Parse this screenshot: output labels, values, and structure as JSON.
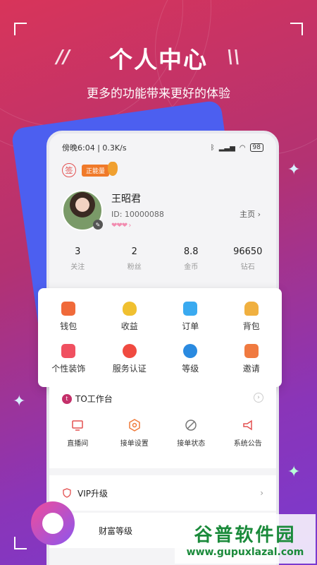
{
  "promo": {
    "headline": "个人中心",
    "subtitle": "更多的功能带来更好的体验"
  },
  "statusbar": {
    "time_info": "傍晚6:04 | 0.3K/s",
    "battery": "98"
  },
  "sign_in": {
    "label": "签"
  },
  "positive_badge": {
    "label": "正能量"
  },
  "profile": {
    "name": "王昭君",
    "id_text": "ID: 10000088",
    "homepage_label": "主页"
  },
  "stats": [
    {
      "value": "3",
      "label": "关注"
    },
    {
      "value": "2",
      "label": "粉丝"
    },
    {
      "value": "8.8",
      "label": "金币"
    },
    {
      "value": "96650",
      "label": "钻石"
    }
  ],
  "menu": [
    {
      "label": "钱包",
      "icon": "wallet-icon",
      "color": "#f06a3a"
    },
    {
      "label": "收益",
      "icon": "moneybag-icon",
      "color": "#f0c030"
    },
    {
      "label": "订单",
      "icon": "order-icon",
      "color": "#3aaaf0"
    },
    {
      "label": "背包",
      "icon": "backpack-icon",
      "color": "#f0b040"
    },
    {
      "label": "个性装饰",
      "icon": "shirt-icon",
      "color": "#f05060"
    },
    {
      "label": "服务认证",
      "icon": "certification-icon",
      "color": "#f04a40"
    },
    {
      "label": "等级",
      "icon": "level-icon",
      "color": "#2a8ae0"
    },
    {
      "label": "邀请",
      "icon": "invite-icon",
      "color": "#f07a40"
    }
  ],
  "workbench": {
    "title": "TO工作台",
    "logo_letter": "t",
    "items": [
      {
        "label": "直播间",
        "icon": "live-room-icon"
      },
      {
        "label": "接单设置",
        "icon": "order-settings-icon"
      },
      {
        "label": "接单状态",
        "icon": "order-status-icon"
      },
      {
        "label": "系统公告",
        "icon": "announcement-icon"
      }
    ]
  },
  "rows": {
    "vip": "VIP升级",
    "wealth": "财富等级"
  },
  "watermark": {
    "main": "谷普软件园",
    "url": "www.gupuxlazal.com"
  },
  "colors": {
    "brand_pink": "#c4306a",
    "brand_purple": "#7a3ad0"
  }
}
